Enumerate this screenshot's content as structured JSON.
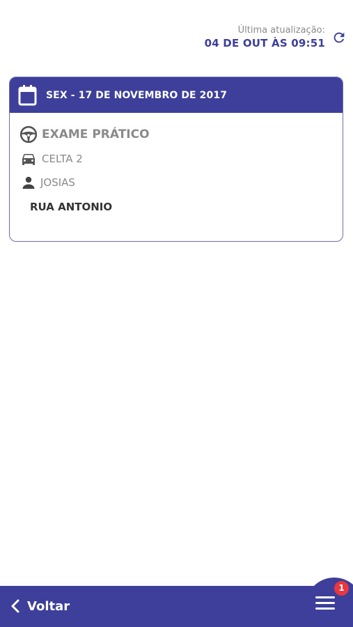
{
  "last_update": {
    "label": "Última atualização:",
    "value": "04 DE OUT ÀS 09:51"
  },
  "schedule_card": {
    "date": "SEX - 17 DE NOVEMBRO DE 2017",
    "exam_type": "EXAME PRÁTICO",
    "vehicle": "CELTA 2",
    "instructor": "JOSIAS",
    "address": "RUA ANTONIO"
  },
  "bottom_bar": {
    "back_label": "Voltar",
    "menu_badge": "1"
  },
  "colors": {
    "primary": "#3d3f9a",
    "muted_text": "#8a8a8a",
    "badge": "#e8373f"
  },
  "icons": {
    "refresh": "refresh-icon",
    "calendar": "calendar-icon",
    "steering": "steering-wheel-icon",
    "car": "car-icon",
    "person": "person-icon",
    "back": "chevron-left-icon",
    "menu": "hamburger-menu-icon"
  }
}
